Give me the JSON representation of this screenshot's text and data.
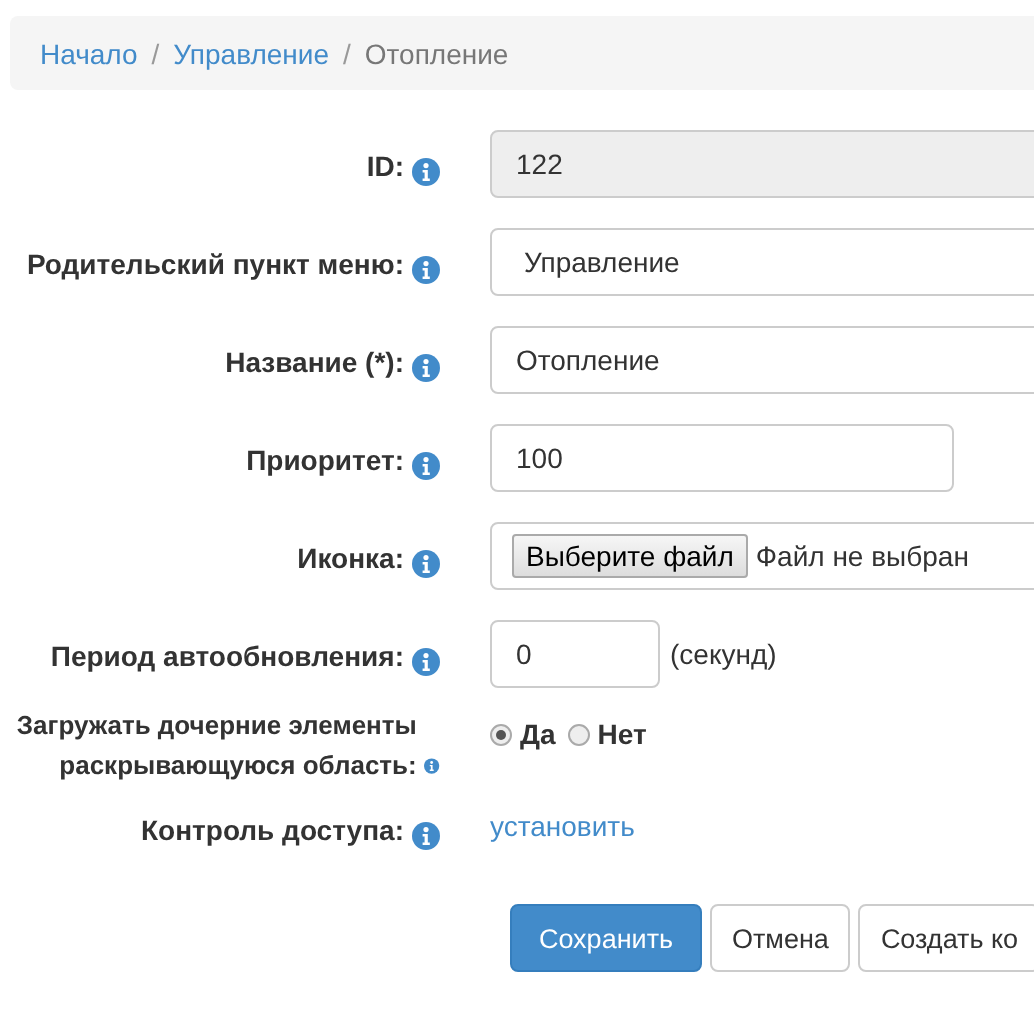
{
  "breadcrumb": [
    {
      "label": "Начало",
      "kind": "link"
    },
    {
      "label": "Управление",
      "kind": "link",
      "separator": "/"
    },
    {
      "label": "Отопление",
      "kind": "current",
      "separator": "/"
    }
  ],
  "fields": [
    {
      "label": "ID:",
      "kind": "text",
      "value": "122",
      "disabled": true
    },
    {
      "label": "Родительский пункт меню:",
      "kind": "select",
      "value": "Управление"
    },
    {
      "label": "Название (*):",
      "kind": "text",
      "value": "Отопление",
      "disabled": false
    },
    {
      "label": "Приоритет:",
      "kind": "short",
      "value": "100"
    },
    {
      "label": "Иконка:",
      "kind": "file",
      "button": "Выберите файл",
      "status": "Файл не выбран"
    },
    {
      "label": "Период автообновления:",
      "kind": "number",
      "value": "0",
      "suffix": "(секунд)"
    },
    {
      "label": "Загружать дочерние элементы раскрывающуюся область:",
      "kind": "radio",
      "options": [
        {
          "label": "Да",
          "selected": true
        },
        {
          "label": "Нет",
          "selected": false
        }
      ]
    },
    {
      "label": "Контроль доступа:",
      "kind": "link",
      "link": "установить"
    }
  ],
  "buttons": [
    {
      "label": "Сохранить",
      "kind": "primary"
    },
    {
      "label": "Отмена",
      "kind": "default"
    },
    {
      "label": "Создать ко",
      "kind": "default"
    }
  ]
}
